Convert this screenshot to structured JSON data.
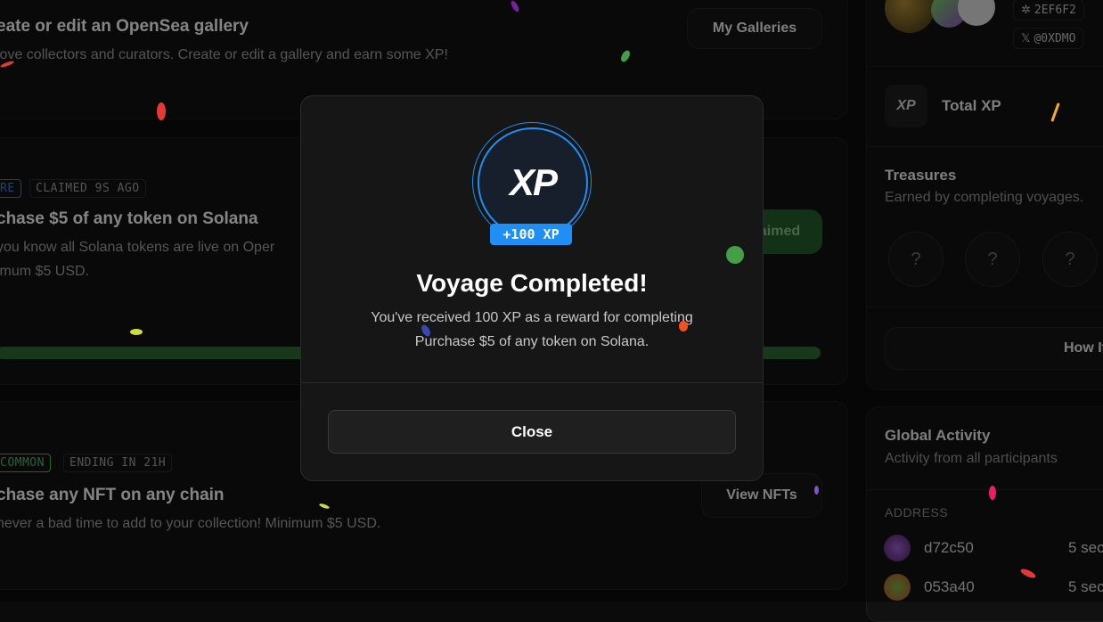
{
  "cards": {
    "gallery": {
      "title": "eate or edit an OpenSea gallery",
      "desc": "love collectors and curators. Create or edit a gallery and earn some XP!",
      "button": "My Galleries"
    },
    "solana": {
      "tag_rarity": "RE",
      "tag_status": "CLAIMED 9S AGO",
      "title": "chase $5 of any token on Solana",
      "desc1": "you know all Solana tokens are live on Oper",
      "desc2": "imum $5 USD.",
      "button": "Claimed",
      "progress": 1
    },
    "nft": {
      "tag_rarity": "COMMON",
      "tag_status": "ENDING IN 21H",
      "title": "chase any NFT on any chain",
      "desc": "never a bad time to add to your collection! Minimum $5 USD.",
      "button": "View NFTs"
    }
  },
  "sidebar": {
    "profile": {
      "address_chip": "2EF6F2",
      "twitter_chip": "@0XDMO"
    },
    "total_xp": {
      "badge": "XP",
      "label": "Total XP"
    },
    "treasures": {
      "title": "Treasures",
      "subtitle": "Earned by completing voyages.",
      "items": [
        "?",
        "?",
        "?"
      ]
    },
    "how_it_works": "How It",
    "global_activity": {
      "title": "Global Activity",
      "subtitle": "Activity from all participants",
      "column": "ADDRESS",
      "rows": [
        {
          "address": "d72c50",
          "time": "5 sec"
        },
        {
          "address": "053a40",
          "time": "5 sec"
        }
      ]
    }
  },
  "modal": {
    "logo_text": "XP",
    "xp_badge": "+100 XP",
    "heading": "Voyage Completed!",
    "line1": "You've received 100 XP as a reward for completing",
    "line2": "Purchase $5 of any token on Solana.",
    "close_label": "Close"
  },
  "colors": {
    "accent_blue": "#1f8ff5",
    "progress_green": "#2b6630",
    "common_green": "#3cbb5a",
    "rare_blue": "#2d7ad6"
  }
}
